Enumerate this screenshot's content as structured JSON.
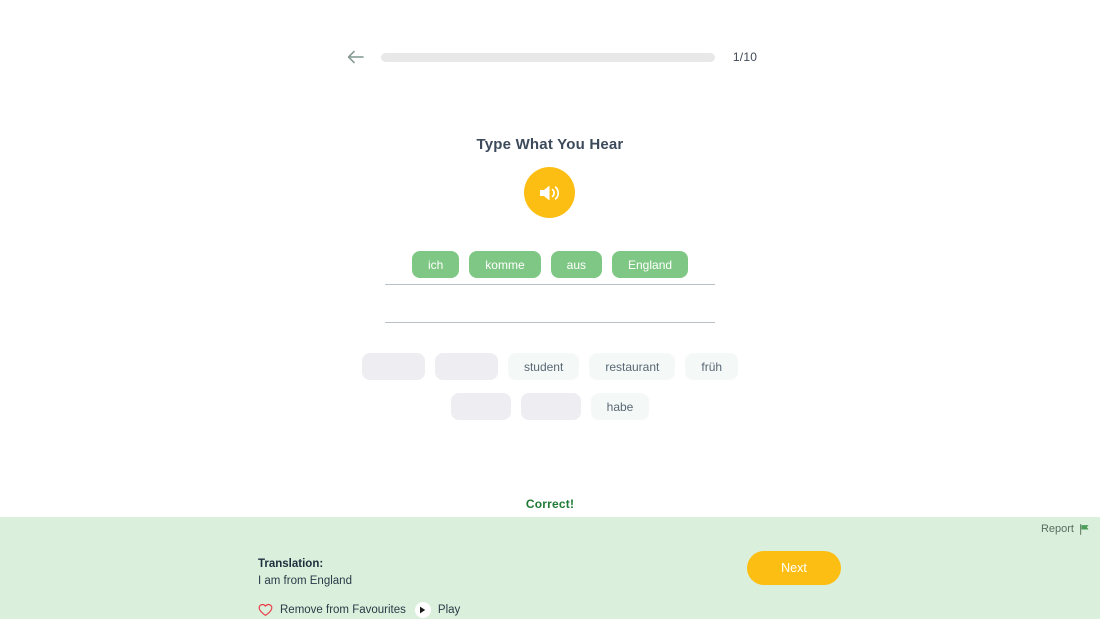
{
  "topbar": {
    "back_icon": "arrow-left-icon",
    "progress": {
      "current": 1,
      "total": 10,
      "label": "1/10",
      "percent": 0
    }
  },
  "exercise": {
    "title": "Type What You Hear",
    "audio_icon": "speaker-icon"
  },
  "answer": {
    "chips": [
      {
        "label": "ich"
      },
      {
        "label": "komme"
      },
      {
        "label": "aus"
      },
      {
        "label": "England"
      }
    ]
  },
  "word_bank": {
    "row1": [
      {
        "label": "",
        "used": true
      },
      {
        "label": "",
        "used": true
      },
      {
        "label": "student",
        "used": false
      },
      {
        "label": "restaurant",
        "used": false
      },
      {
        "label": "früh",
        "used": false
      }
    ],
    "row2": [
      {
        "label": "",
        "used": true
      },
      {
        "label": "",
        "used": true
      },
      {
        "label": "habe",
        "used": false
      }
    ]
  },
  "feedback": {
    "status": "Correct!",
    "report_label": "Report",
    "report_icon": "flag-icon",
    "translation_label": "Translation:",
    "translation_value": "I am from England",
    "favourite_label": "Remove from Favourites",
    "favourite_icon": "heart-icon",
    "play_label": "Play",
    "play_icon": "play-icon",
    "next_label": "Next"
  },
  "colors": {
    "accent": "#FCBE13",
    "chip_green": "#7fc784",
    "panel_green": "#dbf0dc",
    "correct_green": "#1f7a35",
    "chip_used": "#ededf2",
    "chip_bank": "#f4f8f6"
  }
}
